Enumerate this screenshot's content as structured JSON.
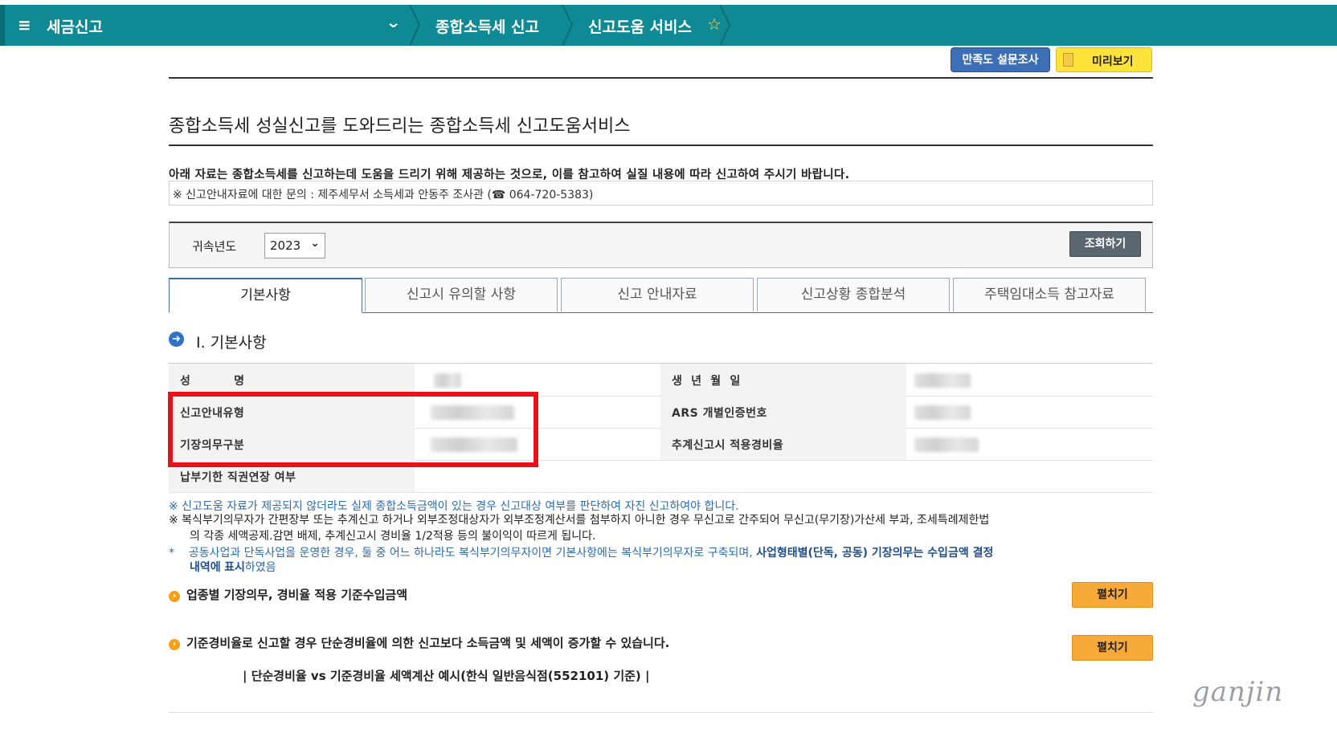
{
  "topnav": {
    "menu_label": "세금신고",
    "crumb1": "종합소득세 신고",
    "crumb2": "신고도움 서비스",
    "bg_color": "#0f8a94"
  },
  "actions": {
    "survey_label": "만족도 설문조사",
    "preview_label": "미리보기"
  },
  "page_title": "종합소득세 성실신고를 도와드리는 종합소득세 신고도움서비스",
  "notice": "아래 자료는 종합소득세를 신고하는데 도움을 드리기 위해 제공하는 것으로, 이를 참고하여 실질 내용에 따라 신고하여 주시기 바랍니다.",
  "inquiry": "※ 신고안내자료에 대한 문의 : 제주세무서 소득세과 안동주 조사관 (☎ 064-720-5383)",
  "search": {
    "label": "귀속년도",
    "year": "2023",
    "query_button": "조회하기"
  },
  "tabs": [
    {
      "label": "기본사항",
      "active": true
    },
    {
      "label": "신고시 유의할 사항",
      "active": false
    },
    {
      "label": "신고 안내자료",
      "active": false
    },
    {
      "label": "신고상황 종합분석",
      "active": false
    },
    {
      "label": "주택임대소득 참고자료",
      "active": false
    }
  ],
  "section": {
    "number_icon": "arrow-circle-icon",
    "title": "Ⅰ. 기본사항"
  },
  "info_table": {
    "rows": [
      {
        "left_label": "성          명",
        "right_label": "생  년  월  일"
      },
      {
        "left_label": "신고안내유형",
        "right_label": "ARS 개별인증번호"
      },
      {
        "left_label": "기장의무구분",
        "right_label": "추계신고시 적용경비율"
      },
      {
        "left_label": "납부기한 직권연장 여부",
        "right_label": ""
      }
    ]
  },
  "notes": {
    "n1": "※  신고도움 자료가 제공되지 않더라도 실제 종합소득금액이 있는 경우 신고대상 여부를 판단하여 자진 신고하여야 합니다.",
    "n2a": "※  복식부기의무자가 간편장부 또는 추계신고 하거나 외부조정대상자가 외부조정계산서를 첨부하지 아니한 경우 무신고로 간주되어 무신고(무기장)가산세 부과, 조세특례제한법",
    "n2b": "의 각종 세액공제.감면 배제, 추계신고시 경비율 1/2적용 등의 불이익이 따르게 됩니다.",
    "n3a": "공동사업과 단독사업을 운영한 경우, 둘 중 어느 하나라도 복식부기의무자이면 기본사항에는 복식부기의무자로 구축되며,",
    "n3a_bold": "사업형태별(단독, 공동) 기장의무는 수입금액 결정",
    "n3b_bold": "내역에",
    "n3b_bold2": "표시",
    "n3b": "하였음"
  },
  "subsections": {
    "s1_title": "업종별 기장의무, 경비율 적용 기준수입금액",
    "s1_button": "펼치기",
    "s2_title": "기준경비율로 신고할 경우 단순경비율에 의한 신고보다 소득금액 및 세액이 증가할 수 있습니다.",
    "s2_button": "펼치기",
    "example_title": "| 단순경비율 vs 기준경비율 세액계산 예시(한식 일반음식점(552101) 기준) |"
  },
  "watermark": "ganjin"
}
